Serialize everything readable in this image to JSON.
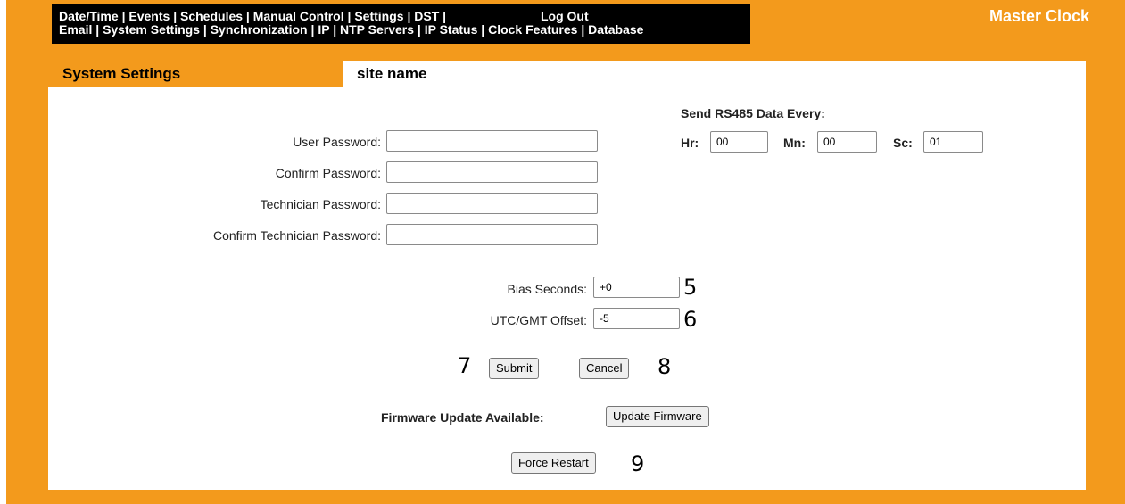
{
  "header": {
    "nav_row1": [
      "Date/Time",
      "Events",
      "Schedules",
      "Manual Control",
      "Settings",
      "DST"
    ],
    "nav_row2": [
      "Email",
      "System Settings",
      "Synchronization",
      "IP",
      "NTP Servers",
      "IP Status",
      "Clock Features",
      "Database"
    ],
    "separator": "|",
    "logout": "Log Out",
    "brand": "Master Clock"
  },
  "page": {
    "section_title": "System Settings",
    "site_name": "site name"
  },
  "passwords": {
    "user_label": "User Password:",
    "user_value": "",
    "confirm_label": "Confirm Password:",
    "confirm_value": "",
    "tech_label": "Technician Password:",
    "tech_value": "",
    "confirm_tech_label": "Confirm Technician Password:",
    "confirm_tech_value": ""
  },
  "rs485": {
    "title": "Send RS485 Data Every:",
    "hr_label": "Hr:",
    "hr_value": "00",
    "mn_label": "Mn:",
    "mn_value": "00",
    "sc_label": "Sc:",
    "sc_value": "01"
  },
  "timing": {
    "bias_label": "Bias Seconds:",
    "bias_value": "+0",
    "utc_label": "UTC/GMT Offset:",
    "utc_value": "-5"
  },
  "actions": {
    "submit_label": "Submit",
    "cancel_label": "Cancel",
    "firmware_label": "Firmware Update Available:",
    "update_firmware_label": "Update Firmware",
    "force_restart_label": "Force Restart"
  },
  "annotations": {
    "n5": "5",
    "n6": "6",
    "n7": "7",
    "n8": "8",
    "n9": "9"
  }
}
